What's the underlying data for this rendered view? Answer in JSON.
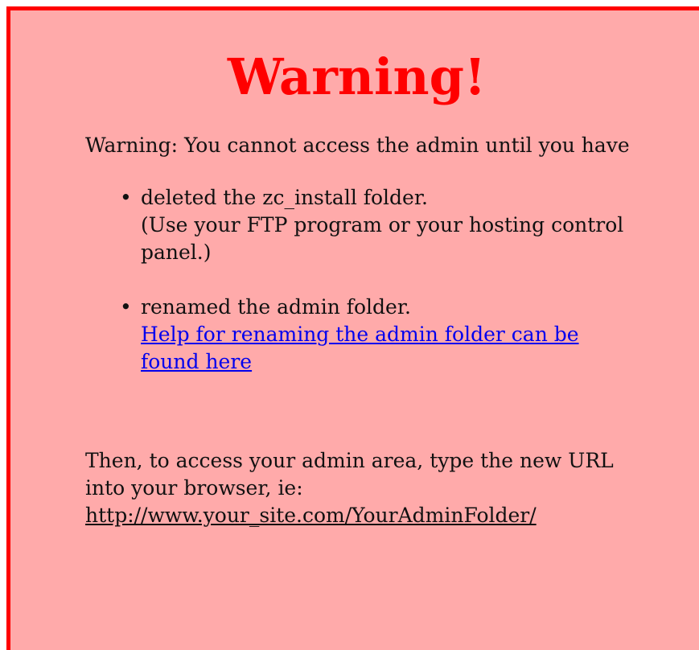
{
  "page": {
    "title": "Warning!",
    "intro": "Warning: You cannot access the admin until you have",
    "requirements": [
      {
        "bullet": "•",
        "line1": "deleted the zc_install folder.",
        "line2": "(Use your FTP program or your hosting control panel.)"
      },
      {
        "bullet": "•",
        "line1": "renamed the admin folder.",
        "link": "Help for renaming the admin folder can be found here"
      }
    ],
    "outro": "Then, to access your admin area, type the new URL into your browser, ie:",
    "example_url": "http://www.your_site.com/YourAdminFolder/"
  },
  "colors": {
    "background": "#ffaaaa",
    "border": "#ff0000",
    "title": "#ff0000",
    "link": "#0000ee"
  }
}
